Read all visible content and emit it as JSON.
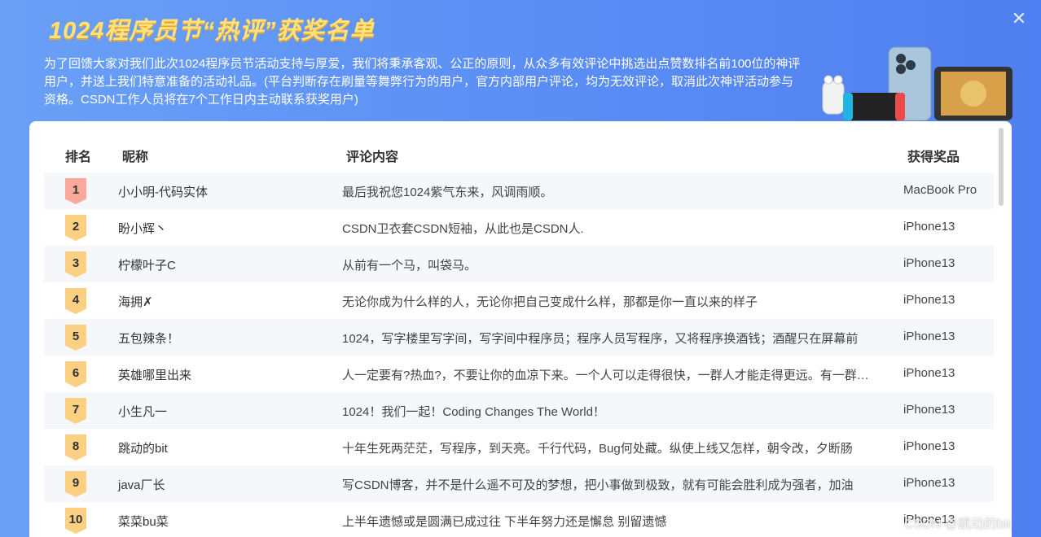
{
  "header": {
    "title": "1024程序员节“热评”获奖名单",
    "intro": "为了回馈大家对我们此次1024程序员节活动支持与厚爱，我们将秉承客观、公正的原则，从众多有效评论中挑选出点赞数排名前100位的神评用户，并送上我们特意准备的活动礼品。(平台判断存在刷量等舞弊行为的用户，官方内部用户评论，均为无效评论，取消此次神评活动参与资格。CSDN工作人员将在7个工作日内主动联系获奖用户)",
    "close_icon": "close-icon"
  },
  "table": {
    "columns": {
      "rank": "排名",
      "nickname": "昵称",
      "comment": "评论内容",
      "prize": "获得奖品"
    },
    "rows": [
      {
        "rank": "1",
        "nickname": "小小明-代码实体",
        "comment": "最后我祝您1024紫气东来，风调雨顺。",
        "prize": "MacBook Pro"
      },
      {
        "rank": "2",
        "nickname": "盼小辉丶",
        "comment": "CSDN卫衣套CSDN短袖，从此也是CSDN人.",
        "prize": "iPhone13"
      },
      {
        "rank": "3",
        "nickname": "柠檬叶子C",
        "comment": "从前有一个马，叫袋马。",
        "prize": "iPhone13"
      },
      {
        "rank": "4",
        "nickname": "海拥✗",
        "comment": "无论你成为什么样的人，无论你把自己变成什么样，那都是你一直以来的样子",
        "prize": "iPhone13"
      },
      {
        "rank": "5",
        "nickname": "五包辣条！",
        "comment": "1024，写字楼里写字间，写字间中程序员；程序人员写程序，又将程序换酒钱；酒醒只在屏幕前",
        "prize": "iPhone13"
      },
      {
        "rank": "6",
        "nickname": "英雄哪里出来",
        "comment": "人一定要有?热血?，不要让你的血凉下来。一个人可以走得很快，一群人才能走得更远。有一群志同道合的人",
        "prize": "iPhone13"
      },
      {
        "rank": "7",
        "nickname": "小生凡一",
        "comment": "1024！我们一起！Coding Changes The World！",
        "prize": "iPhone13"
      },
      {
        "rank": "8",
        "nickname": "跳动的bit",
        "comment": "十年生死两茫茫，写程序，到天亮。千行代码，Bug何处藏。纵使上线又怎样，朝令改，夕断肠",
        "prize": "iPhone13"
      },
      {
        "rank": "9",
        "nickname": "java厂长",
        "comment": "写CSDN博客，并不是什么遥不可及的梦想，把小事做到极致，就有可能会胜利成为强者，加油",
        "prize": "iPhone13"
      },
      {
        "rank": "10",
        "nickname": "菜菜bu菜",
        "comment": "上半年遗憾或是圆满已成过往 下半年努力还是懈怠 别留遗憾",
        "prize": "iPhone13"
      }
    ]
  },
  "watermark": "CSDN @跳动的bit",
  "colors": {
    "background": "#5b8ff5",
    "title": "#ffe27a",
    "rank_badge": "#fbd083",
    "rank_first": "#f9a89a"
  }
}
